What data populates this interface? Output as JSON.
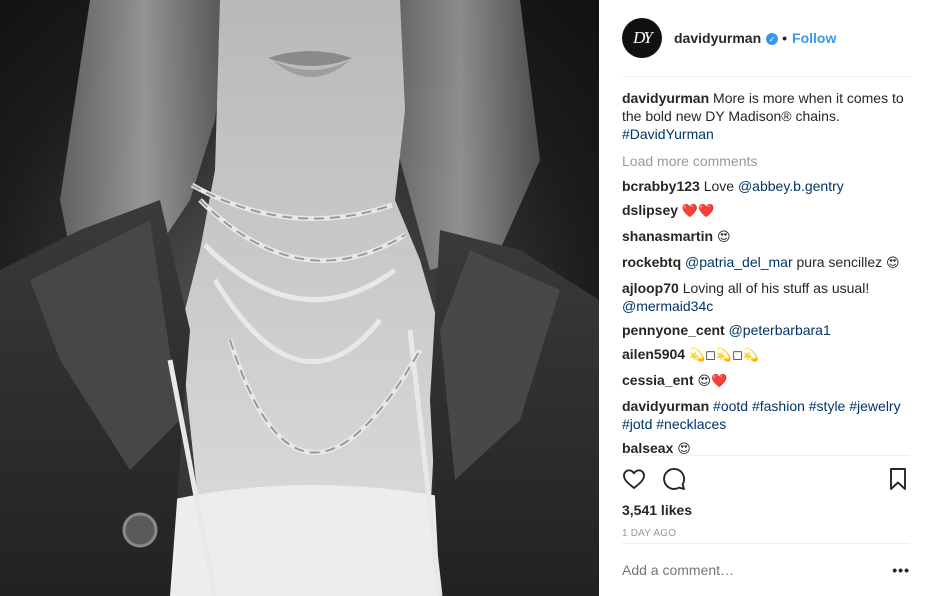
{
  "header": {
    "avatar_text": "DY",
    "username": "davidyurman",
    "verified_icon": "verified-badge-icon",
    "separator": "•",
    "follow_label": "Follow"
  },
  "caption": {
    "username": "davidyurman",
    "text": "More is more when it comes to the bold new DY Madison® chains.",
    "hashtag": "#DavidYurman"
  },
  "load_more": "Load more comments",
  "comments": [
    {
      "user": "bcrabby123",
      "text": "Love ",
      "mention": "@abbey.b.gentry"
    },
    {
      "user": "dslipsey",
      "emoji": "❤️❤️"
    },
    {
      "user": "shanasmartin",
      "emoji": "😍"
    },
    {
      "user": "rockebtq",
      "mention": "@patria_del_mar",
      "text": " pura sencillez ",
      "emoji": "😍"
    },
    {
      "user": "ajloop70",
      "text": "Loving all of his stuff as usual!",
      "mention": "@mermaid34c"
    },
    {
      "user": "pennyone_cent",
      "mention": "@peterbarbara1"
    },
    {
      "user": "ailen5904",
      "emoji": "💫◻💫◻💫"
    },
    {
      "user": "cessia_ent",
      "emoji": "😍❤️"
    },
    {
      "user": "davidyurman",
      "tags": "#ootd #fashion #style #jewelry #jotd #necklaces"
    },
    {
      "user": "balseax",
      "emoji": "😍"
    }
  ],
  "actions": {
    "like_icon": "heart-icon",
    "comment_icon": "comment-icon",
    "save_icon": "bookmark-icon"
  },
  "likes": "3,541 likes",
  "time": "1 DAY AGO",
  "add_comment_placeholder": "Add a comment…",
  "more_label": "•••",
  "colors": {
    "link": "#003569",
    "follow": "#3897f0",
    "muted": "#999999",
    "text": "#262626"
  }
}
